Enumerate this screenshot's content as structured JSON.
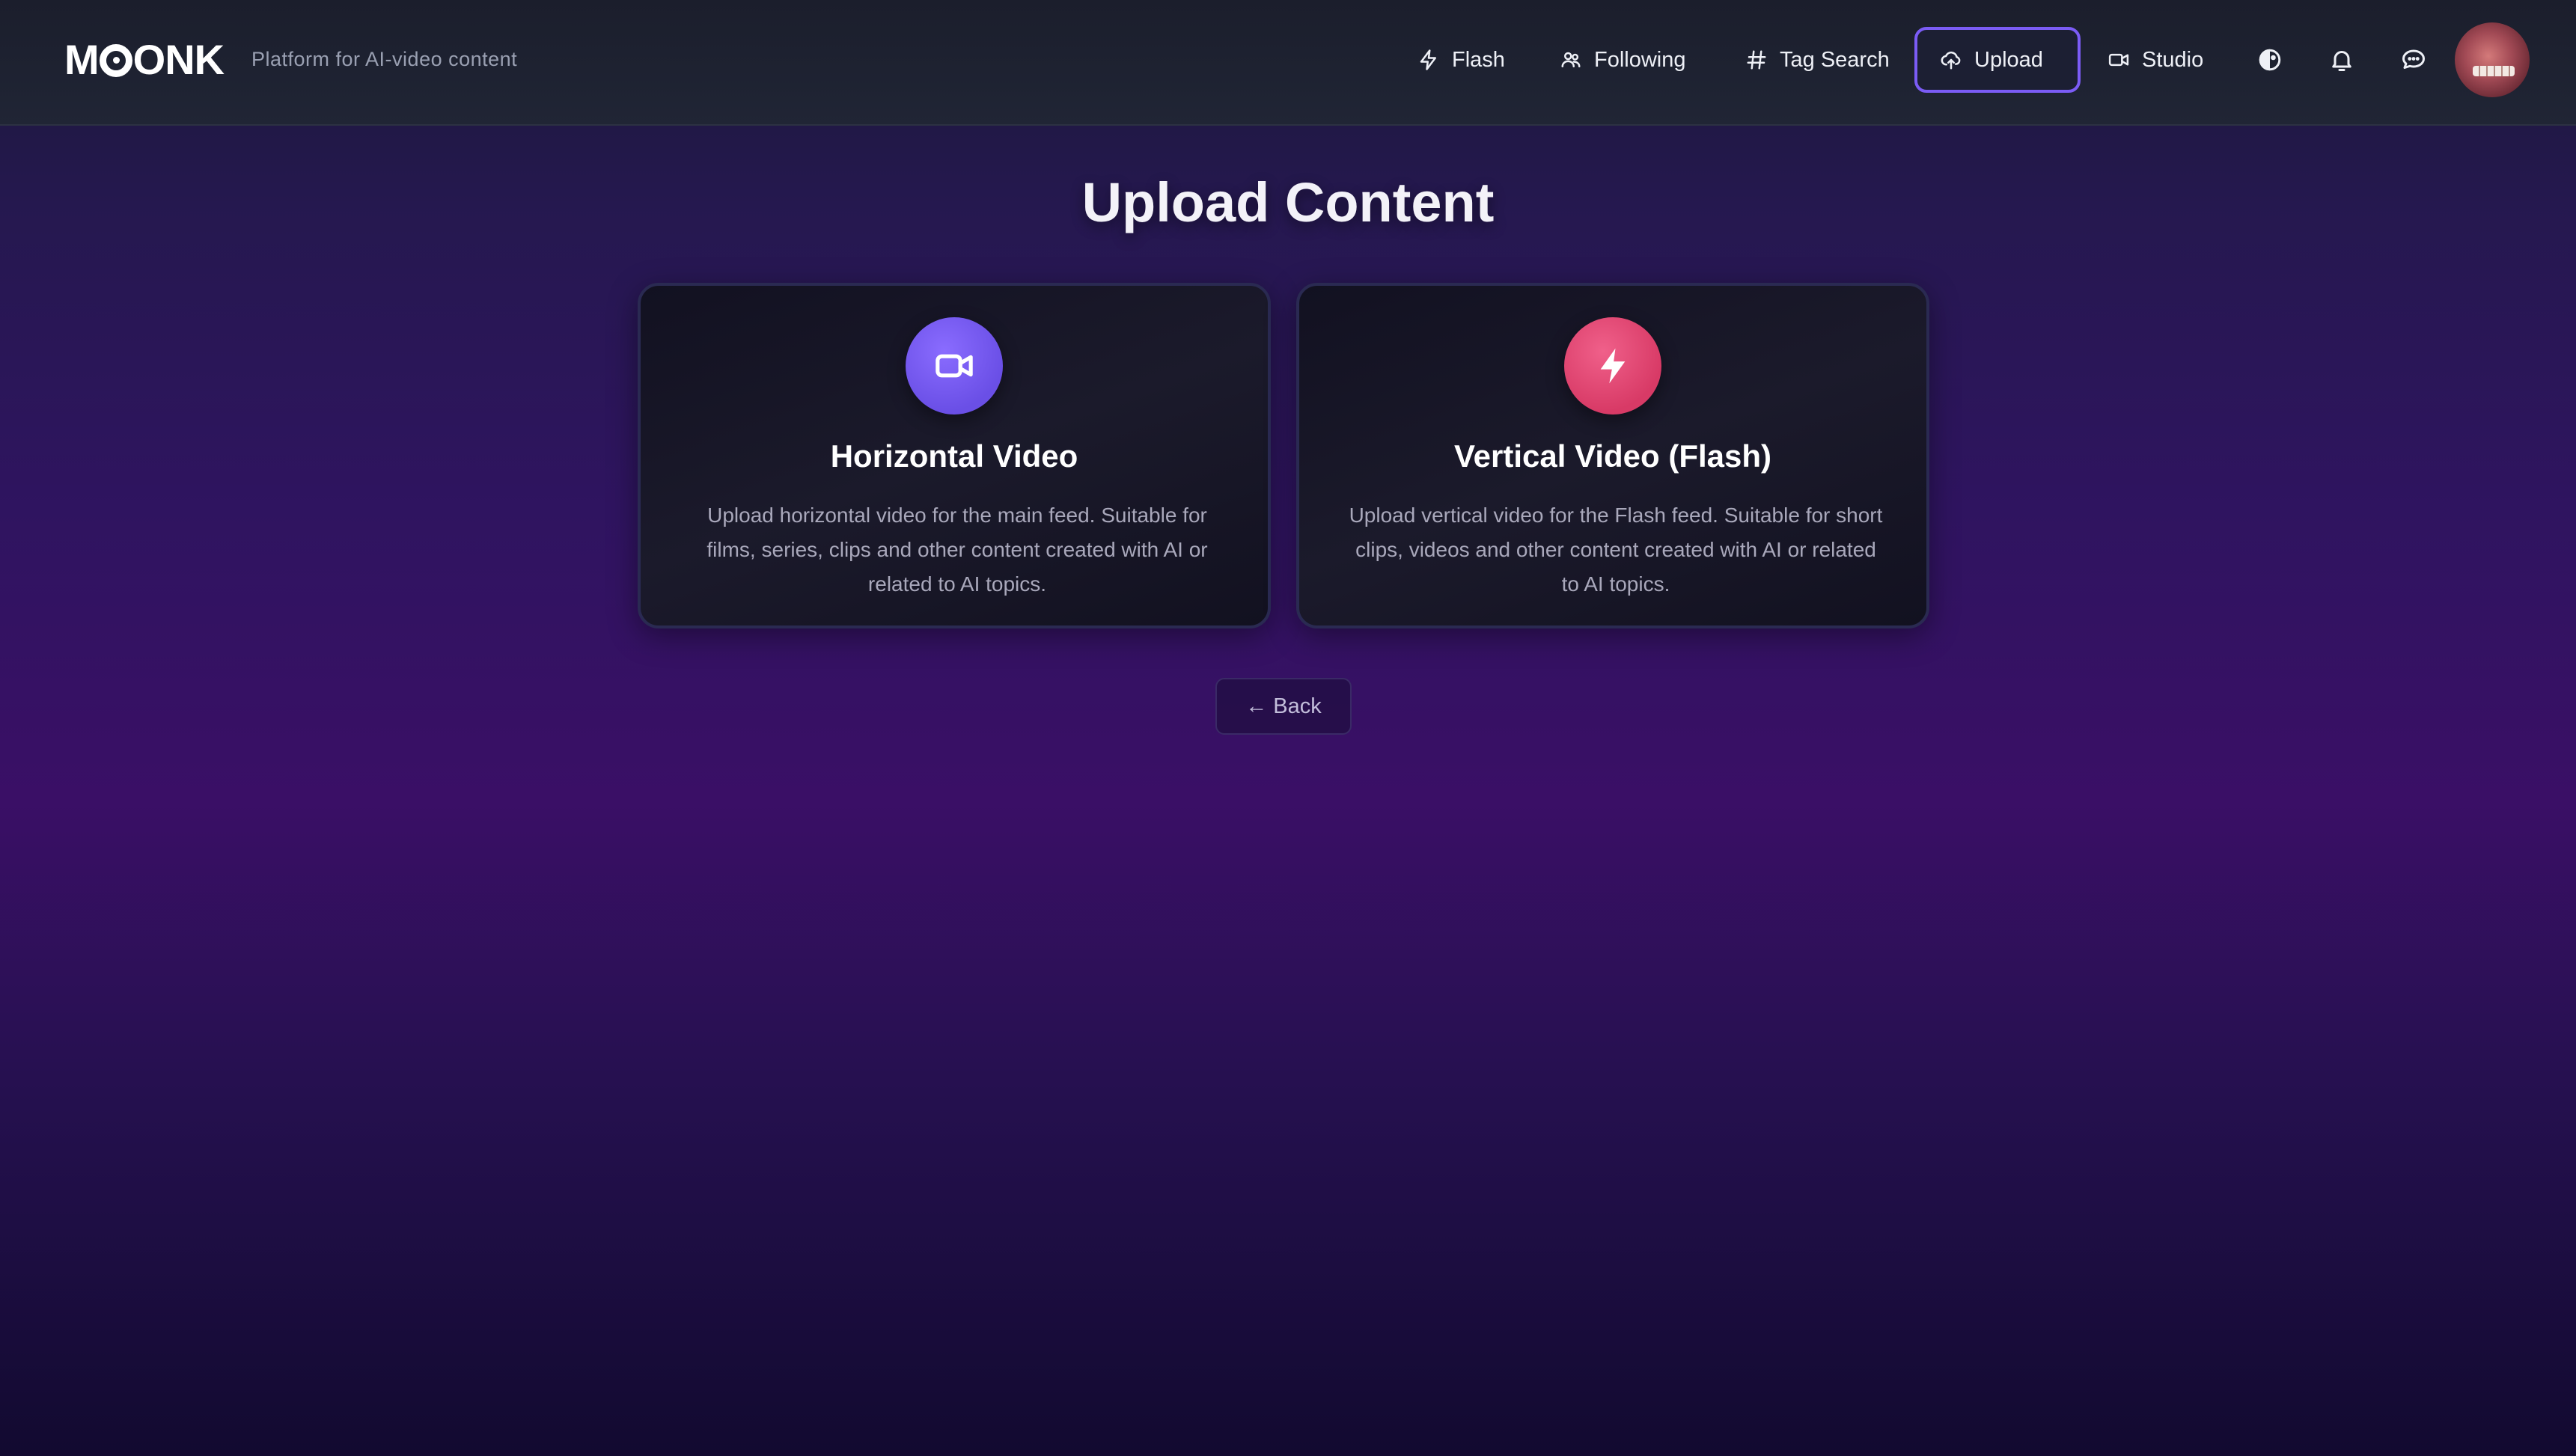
{
  "header": {
    "logo_text_a": "M",
    "logo_text_b": "ONK",
    "tagline": "Platform for AI-video content",
    "nav": [
      {
        "label": "Flash",
        "icon": "lightning-icon"
      },
      {
        "label": "Following",
        "icon": "users-icon"
      },
      {
        "label": "Tag Search",
        "icon": "hash-icon"
      },
      {
        "label": "Upload",
        "icon": "cloud-upload-icon",
        "active": true
      },
      {
        "label": "Studio",
        "icon": "video-camera-icon"
      }
    ],
    "icons": [
      "theme-toggle-icon",
      "bell-icon",
      "chat-icon"
    ]
  },
  "main": {
    "title": "Upload Content",
    "cards": [
      {
        "title": "Horizontal Video",
        "description": "Upload horizontal video for the main feed. Suitable for films, series, clips and other content created with AI or related to AI topics.",
        "icon": "video-camera-icon",
        "color": "#7356ee"
      },
      {
        "title": "Vertical Video (Flash)",
        "description": "Upload vertical video for the Flash feed. Suitable for short clips, videos and other content created with AI or related to AI topics.",
        "icon": "lightning-icon",
        "color": "#e0416f"
      }
    ],
    "back_label": "← Back"
  },
  "colors": {
    "accent": "#7b5cf5",
    "header_bg": "#1e2232"
  }
}
